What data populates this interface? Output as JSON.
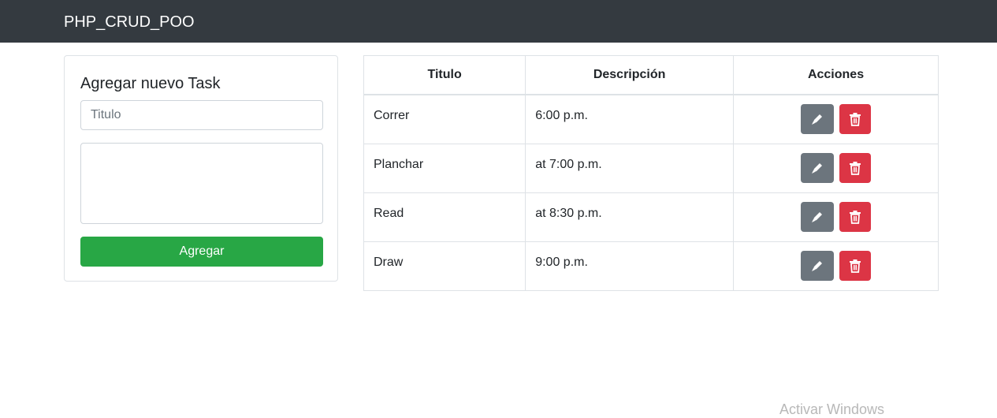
{
  "navbar": {
    "brand": "PHP_CRUD_POO"
  },
  "form": {
    "title": "Agregar nuevo Task",
    "titulo_placeholder": "Titulo",
    "titulo_value": "",
    "descripcion_value": "",
    "submit_label": "Agregar"
  },
  "table": {
    "headers": [
      "Titulo",
      "Descripción",
      "Acciones"
    ],
    "rows": [
      {
        "titulo": "Correr",
        "descripcion": "6:00 p.m."
      },
      {
        "titulo": "Planchar",
        "descripcion": "at 7:00 p.m."
      },
      {
        "titulo": "Read",
        "descripcion": "at 8:30 p.m."
      },
      {
        "titulo": "Draw",
        "descripcion": "9:00 p.m."
      }
    ],
    "row_actions": [
      "edit-icon",
      "trash-icon"
    ]
  },
  "watermark": {
    "text": "Activar Windows"
  },
  "colors": {
    "navbar": "#343a40",
    "success": "#28a745",
    "secondary": "#6c757d",
    "danger": "#dc3545"
  }
}
